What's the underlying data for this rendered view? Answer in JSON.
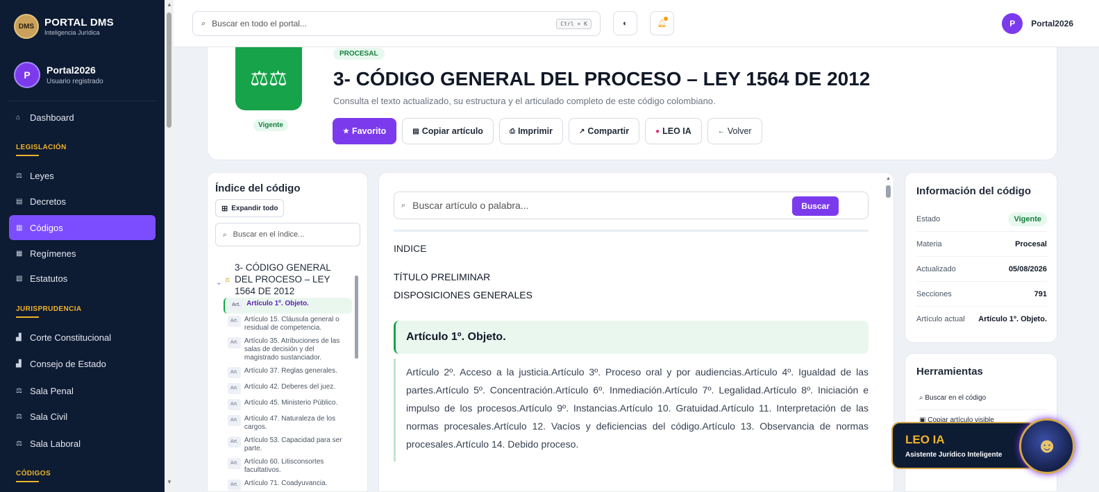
{
  "brand": {
    "logo_text": "DMS",
    "title": "PORTAL DMS",
    "subtitle": "Inteligencia Jurídica"
  },
  "user": {
    "initial": "P",
    "name": "Portal2026",
    "role": "Usuario registrado"
  },
  "nav": {
    "dashboard": "Dashboard",
    "section_legislacion": "LEGISLACIÓN",
    "leyes": "Leyes",
    "decretos": "Decretos",
    "codigos": "Códigos",
    "regimenes": "Regímenes",
    "estatutos": "Estatutos",
    "section_jurisprudencia": "JURISPRUDENCIA",
    "corte": "Corte Constitucional",
    "consejo": "Consejo de Estado",
    "sala_penal": "Sala Penal",
    "sala_civil": "Sala Civil",
    "sala_laboral": "Sala Laboral",
    "section_codigos": "CÓDIGOS"
  },
  "topbar": {
    "search_placeholder": "Buscar en todo el portal...",
    "shortcut": "Ctrl + K",
    "user_initial": "P",
    "user_name": "Portal2026"
  },
  "hero": {
    "tag": "PROCESAL",
    "status": "Vigente",
    "title": "3- CÓDIGO GENERAL DEL PROCESO – LEY 1564 DE 2012",
    "subtitle": "Consulta el texto actualizado, su estructura y el articulado completo de este código colombiano.",
    "actions": {
      "favorito": "Favorito",
      "copiar": "Copiar artículo",
      "imprimir": "Imprimir",
      "compartir": "Compartir",
      "leo": "LEO IA",
      "volver": "Volver"
    }
  },
  "index": {
    "title": "Índice del código",
    "expand": "Expandir todo",
    "search_placeholder": "Buscar en el índice...",
    "root": "3- CÓDIGO GENERAL DEL PROCESO – LEY 1564 DE 2012",
    "badge": "Art.",
    "items": [
      "Artículo 1º. Objeto.",
      "Artículo 15. Cláusula general o residual de competencia.",
      "Artículo 35. Atribuciones de las salas de decisión y del magistrado sustanciador.",
      "Artículo 37. Reglas generales.",
      "Artículo 42. Deberes del juez.",
      "Artículo 45. Ministerio Público.",
      "Artículo 47. Naturaleza de los cargos.",
      "Artículo 53. Capacidad para ser parte.",
      "Artículo 60. Litisconsortes facultativos.",
      "Artículo 71. Coadyuvancia."
    ]
  },
  "content": {
    "search_placeholder": "Buscar artículo o palabra...",
    "search_button": "Buscar",
    "index_label": "INDICE",
    "titulo": "TÍTULO PRELIMINAR",
    "disposiciones": "DISPOSICIONES GENERALES",
    "article_heading": "Artículo 1º. Objeto.",
    "article_body": "Artículo 2º. Acceso a la justicia.Artículo 3º. Proceso oral y por audiencias.Artículo 4º. Igualdad de las partes.Artículo 5º. Concentración.Artículo 6º. Inmediación.Artículo 7º. Legalidad.Artículo 8º. Iniciación e impulso de los procesos.Artículo 9º. Instancias.Artículo 10. Gratuidad.Artículo 11. Interpretación de las normas procesales.Artículo 12. Vacíos y deficiencias del código.Artículo 13. Observancia de normas procesales.Artículo 14. Debido proceso."
  },
  "info": {
    "title": "Información del código",
    "rows": [
      {
        "k": "Estado",
        "v": "Vigente"
      },
      {
        "k": "Materia",
        "v": "Procesal"
      },
      {
        "k": "Actualizado",
        "v": "05/08/2026"
      },
      {
        "k": "Secciones",
        "v": "791"
      },
      {
        "k": "Artículo actual",
        "v": "Artículo 1º. Objeto."
      }
    ]
  },
  "tools": {
    "title": "Herramientas",
    "buscar": "Buscar en el código",
    "copiar": "Copiar artículo visible"
  },
  "leo": {
    "title": "LEO IA",
    "subtitle": "Asistente Jurídico Inteligente"
  },
  "colors": {
    "sidebar": "#0d1b33",
    "accent": "#7c3aed",
    "active_nav": "#7c4dff",
    "success": "#16a34a",
    "gold": "#f0b429"
  }
}
